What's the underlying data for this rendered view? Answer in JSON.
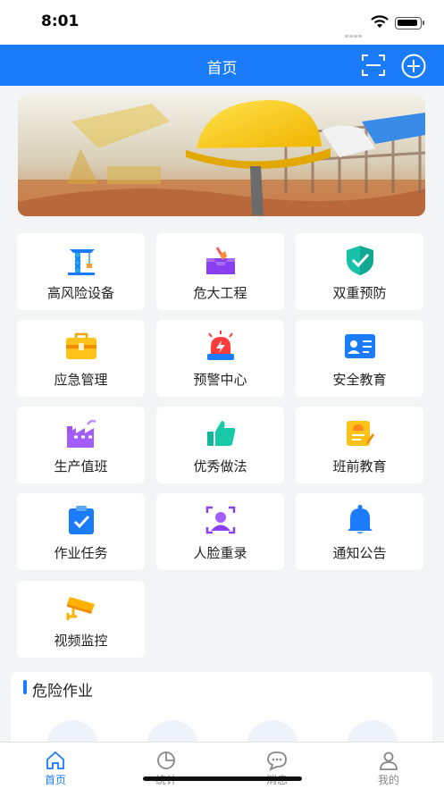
{
  "status": {
    "time": "8:01"
  },
  "nav": {
    "title": "首页"
  },
  "grid": [
    {
      "label": "高风险设备",
      "icon": "crane-icon"
    },
    {
      "label": "危大工程",
      "icon": "shovel-icon"
    },
    {
      "label": "双重预防",
      "icon": "shield-check-icon"
    },
    {
      "label": "应急管理",
      "icon": "toolbox-icon"
    },
    {
      "label": "预警中心",
      "icon": "alarm-light-icon"
    },
    {
      "label": "安全教育",
      "icon": "id-card-icon"
    },
    {
      "label": "生产值班",
      "icon": "factory-icon"
    },
    {
      "label": "优秀做法",
      "icon": "thumbs-up-icon"
    },
    {
      "label": "班前教育",
      "icon": "notepad-helmet-icon"
    },
    {
      "label": "作业任务",
      "icon": "clipboard-check-icon"
    },
    {
      "label": "人脸重录",
      "icon": "face-scan-icon"
    },
    {
      "label": "通知公告",
      "icon": "bell-icon"
    },
    {
      "label": "视频监控",
      "icon": "cctv-camera-icon"
    }
  ],
  "section": {
    "title": "危险作业"
  },
  "tabs": [
    {
      "label": "首页",
      "icon": "home-icon",
      "active": true
    },
    {
      "label": "统计",
      "icon": "pie-chart-icon",
      "active": false
    },
    {
      "label": "消息",
      "icon": "chat-icon",
      "active": false
    },
    {
      "label": "我的",
      "icon": "user-icon",
      "active": false
    }
  ],
  "colors": {
    "primary": "#1a7bfb",
    "background": "#f3f4f6"
  }
}
